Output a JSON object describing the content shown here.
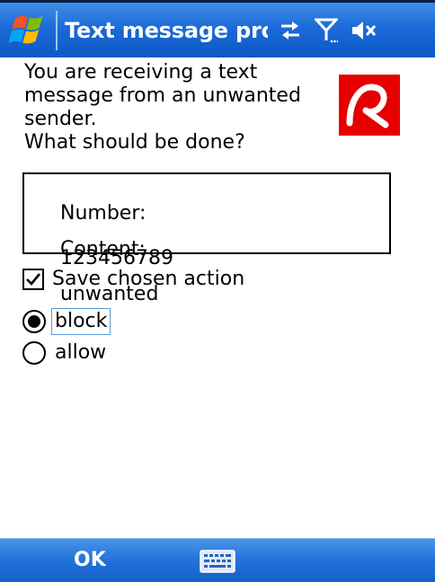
{
  "titlebar": {
    "title": "Text message protec",
    "start_icon": "windows-flag-icon",
    "status_icons": [
      "connectivity-icon",
      "signal-icon",
      "volume-muted-icon"
    ]
  },
  "prompt": {
    "text": "You are receiving a text\nmessage from an unwanted\nsender.\nWhat should be done?"
  },
  "logo": {
    "icon": "avira-umbrella-icon",
    "color": "#e60000"
  },
  "info": {
    "number_label": "Number:",
    "number_value": "123456789",
    "content_label": "Content:",
    "content_value": "unwanted"
  },
  "save_action": {
    "label": "Save chosen action",
    "checked": true
  },
  "options": {
    "selected": "block",
    "block_label": "block",
    "allow_label": "allow"
  },
  "softkeys": {
    "left_label": "OK",
    "center_icon": "keyboard-icon"
  },
  "colors": {
    "titlebar": "#1c6bd8",
    "softkey_bar": "#2272d9",
    "focus_outline": "#5a9bd5"
  }
}
